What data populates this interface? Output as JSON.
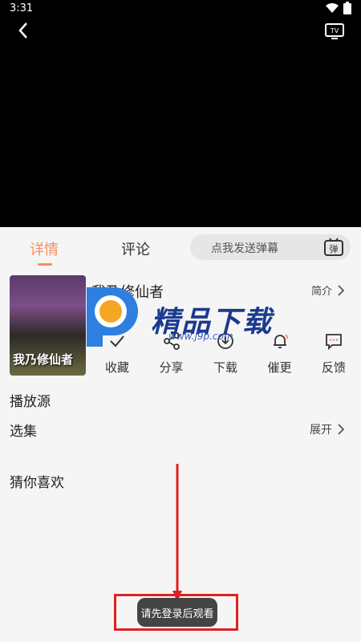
{
  "status_bar": {
    "time": "3:31"
  },
  "tabs": [
    {
      "label": "详情"
    },
    {
      "label": "评论"
    }
  ],
  "danmaku": {
    "placeholder": "点我发送弹幕",
    "icon_text": "弹"
  },
  "show": {
    "title": "我乃修仙者",
    "poster_title": "我乃修仙者",
    "intro_label": "简介"
  },
  "actions": [
    {
      "label": "收藏",
      "icon": "check-icon"
    },
    {
      "label": "分享",
      "icon": "share-icon"
    },
    {
      "label": "下载",
      "icon": "download-icon"
    },
    {
      "label": "催更",
      "icon": "bell-icon"
    },
    {
      "label": "反馈",
      "icon": "feedback-icon"
    }
  ],
  "sections": {
    "source_label": "播放源",
    "episodes_label": "选集",
    "expand_label": "展开",
    "recommend_label": "猜你喜欢"
  },
  "watermark": {
    "text": "精品下载",
    "url": "www.j9p.com"
  },
  "toast": {
    "text": "请先登录后观看"
  },
  "colors": {
    "accent": "#ff8a5c",
    "annotation": "#e02020"
  }
}
